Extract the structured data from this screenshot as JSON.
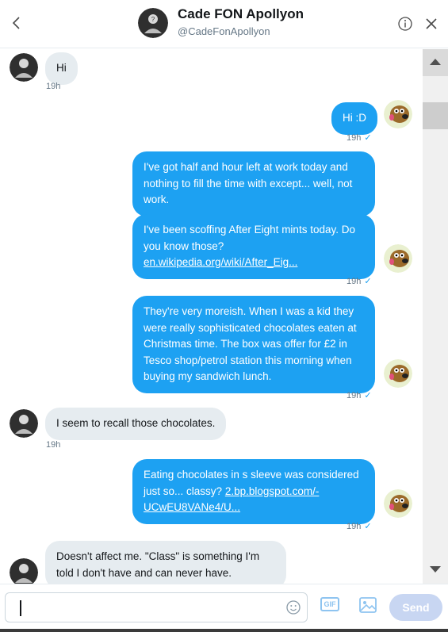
{
  "header": {
    "name": "Cade FON Apollyon",
    "handle": "@CadeFonApollyon",
    "back_icon": "chevron-left-icon",
    "info_icon": "info-icon",
    "close_icon": "close-icon"
  },
  "messages": [
    {
      "direction": "in",
      "text": "Hi",
      "time": "19h"
    },
    {
      "direction": "out",
      "text": "Hi :D",
      "time": "19h",
      "read": true
    },
    {
      "direction": "out",
      "text": "I've got half and hour left at work today and nothing to fill the time with except... well, not work."
    },
    {
      "direction": "out",
      "text": "I've been scoffing After Eight mints today. Do you know those?",
      "link": "en.wikipedia.org/wiki/After_Eig...",
      "time": "19h",
      "read": true
    },
    {
      "direction": "out",
      "text": "They're very moreish. When I was a kid they were really sophisticated chocolates eaten at Christmas time. The box was offer for £2 in Tesco shop/petrol station this morning when buying my sandwich lunch.",
      "time": "19h",
      "read": true
    },
    {
      "direction": "in",
      "text": "I seem to recall those chocolates.",
      "time": "19h"
    },
    {
      "direction": "out",
      "text": "Eating chocolates in s sleeve was considered just so... classy?",
      "link": "2.bp.blogspot.com/-UCwEU8VANe4/U...",
      "time": "19h",
      "read": true
    },
    {
      "direction": "in",
      "text": "Doesn't affect me. \"Class\" is something I'm told I don't have and can never have."
    }
  ],
  "read_mark": "✓",
  "composer": {
    "placeholder": "",
    "gif_label": "GIF",
    "send_label": "Send",
    "emoji_icon": "emoji-icon",
    "image_icon": "image-icon"
  },
  "colors": {
    "outgoing_bubble": "#1da1f2",
    "incoming_bubble": "#e6ecf0",
    "send_disabled": "#c8d6f2"
  }
}
